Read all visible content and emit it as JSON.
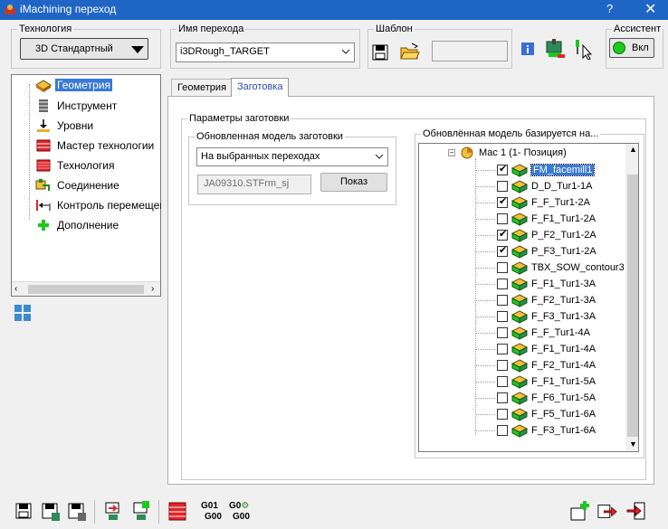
{
  "window": {
    "title": "iMachining переход",
    "help": "?",
    "close": "✕"
  },
  "technology": {
    "label": "Технология",
    "value": "3D Стандартный"
  },
  "operation_name": {
    "label": "Имя перехода",
    "value": "i3DRough_TARGET"
  },
  "template": {
    "label": "Шаблон",
    "value": ""
  },
  "assistant": {
    "label": "Ассистент",
    "toggle": "Вкл"
  },
  "nav_tree": {
    "items": [
      {
        "label": "Геометрия",
        "icon": "geometry-icon",
        "selected": true
      },
      {
        "label": "Инструмент",
        "icon": "tool-icon",
        "selected": false
      },
      {
        "label": "Уровни",
        "icon": "levels-icon",
        "selected": false
      },
      {
        "label": "Мастер технологии",
        "icon": "tech-wizard-icon",
        "selected": false
      },
      {
        "label": "Технология",
        "icon": "technology-icon",
        "selected": false
      },
      {
        "label": "Соединение",
        "icon": "link-icon",
        "selected": false
      },
      {
        "label": "Контроль перемещений",
        "icon": "motion-control-icon",
        "selected": false
      },
      {
        "label": "Дополнение",
        "icon": "misc-plus-icon",
        "selected": false
      }
    ]
  },
  "tabs": [
    {
      "label": "Геометрия",
      "active": false
    },
    {
      "label": "Заготовка",
      "active": true
    }
  ],
  "stock_params": {
    "group_label": "Параметры заготовки",
    "updated_model": {
      "label": "Обновленная модель заготовки",
      "mode_value": "На выбранных переходах",
      "model_name": "JA09310.STFrm_sj",
      "show_button": "Показ"
    }
  },
  "based_on": {
    "label": "Обновлённая модель базируется на...",
    "root": "Мас 1 (1- Позиция)",
    "items": [
      {
        "label": "FM_facemill1",
        "checked": true,
        "selected": true
      },
      {
        "label": "D_D_Tur1-1A",
        "checked": false,
        "selected": false
      },
      {
        "label": "F_F_Tur1-2A",
        "checked": true,
        "selected": false
      },
      {
        "label": "F_F1_Tur1-2A",
        "checked": false,
        "selected": false
      },
      {
        "label": "P_F2_Tur1-2A",
        "checked": true,
        "selected": false
      },
      {
        "label": "P_F3_Tur1-2A",
        "checked": true,
        "selected": false
      },
      {
        "label": "TBX_SOW_contour3",
        "checked": false,
        "selected": false
      },
      {
        "label": "F_F1_Tur1-3A",
        "checked": false,
        "selected": false
      },
      {
        "label": "F_F2_Tur1-3A",
        "checked": false,
        "selected": false
      },
      {
        "label": "F_F3_Tur1-3A",
        "checked": false,
        "selected": false
      },
      {
        "label": "F_F_Tur1-4A",
        "checked": false,
        "selected": false
      },
      {
        "label": "F_F1_Tur1-4A",
        "checked": false,
        "selected": false
      },
      {
        "label": "F_F2_Tur1-4A",
        "checked": false,
        "selected": false
      },
      {
        "label": "F_F1_Tur1-5A",
        "checked": false,
        "selected": false
      },
      {
        "label": "F_F6_Tur1-5A",
        "checked": false,
        "selected": false
      },
      {
        "label": "F_F5_Tur1-6A",
        "checked": false,
        "selected": false
      },
      {
        "label": "F_F3_Tur1-6A",
        "checked": false,
        "selected": false
      }
    ]
  },
  "bottom_toolbar": {
    "gcode1_top": "G01",
    "gcode1_bottom": "G00",
    "gcode2_top": "G0",
    "gcode2_bottom": "G00"
  },
  "colors": {
    "titlebar": "#1f65c6",
    "selection": "#3a7ad6",
    "accent_green": "#1ec81e",
    "accent_red": "#e0252b"
  }
}
